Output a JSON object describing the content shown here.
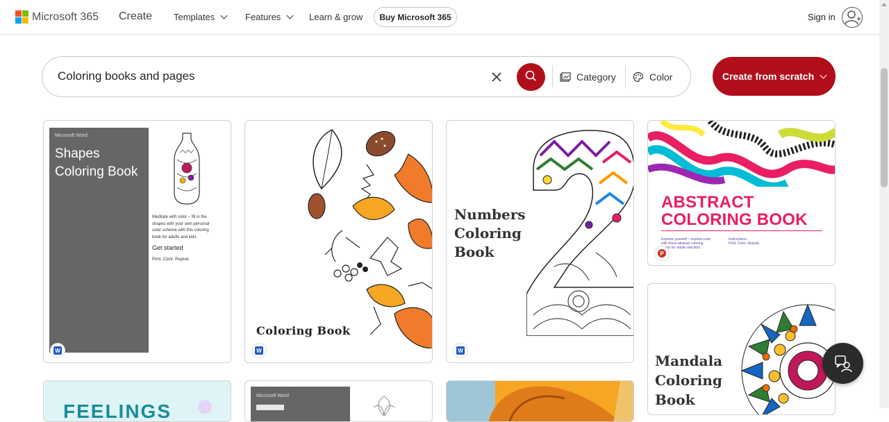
{
  "header": {
    "brand": "Microsoft 365",
    "create": "Create",
    "nav": [
      {
        "label": "Templates"
      },
      {
        "label": "Features"
      },
      {
        "label": "Learn & grow"
      }
    ],
    "buy_button": "Buy Microsoft 365",
    "signin": "Sign in",
    "logo_colors": [
      "#f25022",
      "#7fba00",
      "#00a4ef",
      "#ffb900"
    ]
  },
  "search": {
    "value": "Coloring books and pages",
    "filters": [
      {
        "label": "Category",
        "icon": "category-icon"
      },
      {
        "label": "Color",
        "icon": "palette-icon"
      }
    ]
  },
  "create_button": "Create from scratch",
  "cards": {
    "shapes": {
      "app": "Word",
      "small_label": "Microsoft Word",
      "title_line1": "Shapes",
      "title_line2": "Coloring Book",
      "body_lines": [
        "Meditate with color – fill in the",
        "shapes with your own personal",
        "color scheme with this coloring",
        "book for adults and kids."
      ],
      "get_started": "Get started",
      "tagline": "Print. Color. Repeat."
    },
    "leaves": {
      "app": "Word",
      "title": "Coloring Book"
    },
    "numbers": {
      "app": "Word",
      "title_lines": [
        "Numbers",
        "Coloring",
        "Book"
      ]
    },
    "abstract": {
      "app": "PowerPoint",
      "title_line1": "ABSTRACT",
      "title_line2": "COLORING BOOK",
      "left_text": [
        "Express yourself – explore color",
        "with these abstract coloring",
        "pages for adults and kids."
      ],
      "right_text": [
        "Instructions:",
        "Print. Color. Repeat."
      ]
    },
    "mandala": {
      "title_lines": [
        "Mandala",
        "Coloring",
        "Book"
      ]
    },
    "feelings": {
      "title": "FEELINGS"
    },
    "word_second": {
      "small_label": "Microsoft Word"
    }
  }
}
